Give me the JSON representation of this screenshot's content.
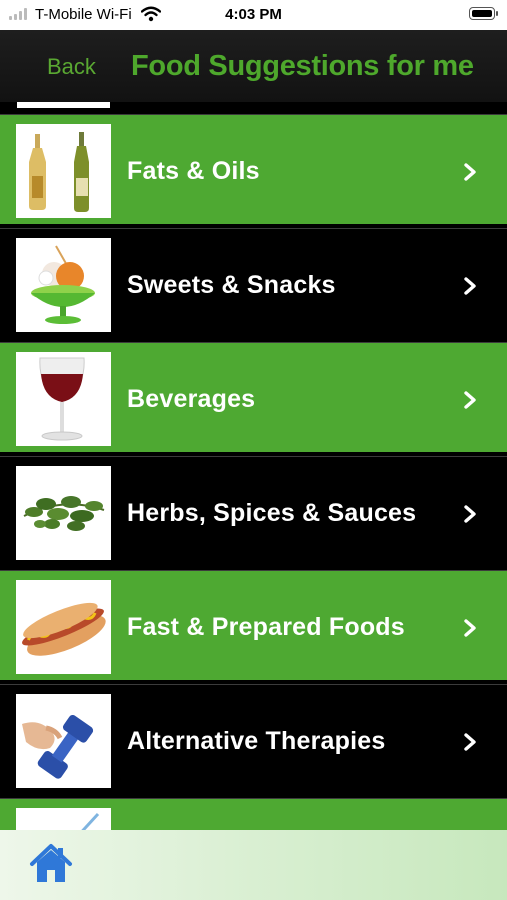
{
  "status_bar": {
    "carrier": "T-Mobile Wi-Fi",
    "time": "4:03 PM",
    "icons": [
      "signal-icon",
      "wifi-icon",
      "battery-icon"
    ]
  },
  "nav": {
    "back_label": "Back",
    "title": "Food Suggestions for me"
  },
  "categories": [
    {
      "label": "Fats & Oils",
      "icon": "oil-bottles-image"
    },
    {
      "label": "Sweets & Snacks",
      "icon": "dessert-cup-image"
    },
    {
      "label": "Beverages",
      "icon": "wine-glass-image"
    },
    {
      "label": "Herbs, Spices & Sauces",
      "icon": "herbs-image"
    },
    {
      "label": "Fast & Prepared Foods",
      "icon": "hot-dog-image"
    },
    {
      "label": "Alternative Therapies",
      "icon": "dumbbell-image"
    }
  ],
  "tab_bar": {
    "items": [
      "home-icon"
    ]
  },
  "colors": {
    "green_row": "#4ea932",
    "black_row": "#000000",
    "title_green": "#4ea82c",
    "tab_bar": "#d9efd2",
    "home_icon": "#2f78d8"
  }
}
